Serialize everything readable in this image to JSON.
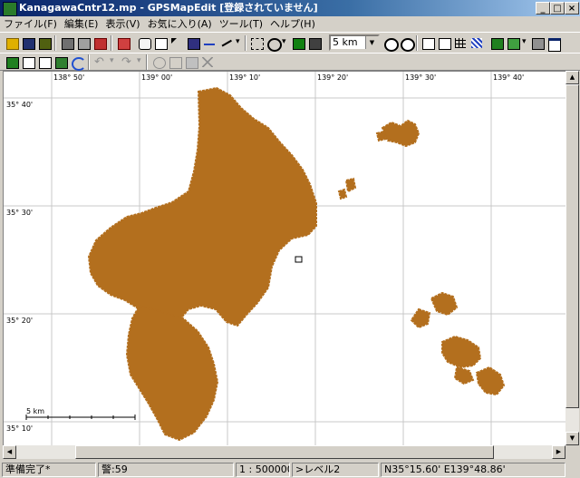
{
  "window": {
    "title": "KanagawaCntr12.mp - GPSMapEdit [登録されていません]"
  },
  "title_buttons": {
    "minimize": "_",
    "maximize": "□",
    "close": "×"
  },
  "menu": [
    "ファイル(F)",
    "編集(E)",
    "表示(V)",
    "お気に入り(A)",
    "ツール(T)",
    "ヘルプ(H)"
  ],
  "toolbar": {
    "scale_value": "5 km",
    "undo_label": "↶",
    "redo_label": "↷",
    "dropdown_arrow": "▾"
  },
  "map": {
    "land_color": "#b36f1e",
    "lon_labels": [
      "138° 50'",
      "139° 00'",
      "139° 10'",
      "139° 20'",
      "139° 30'",
      "139° 40'"
    ],
    "lat_labels": [
      "35° 40'",
      "35° 30'",
      "35° 20'",
      "35° 10'"
    ],
    "scale_bar_label": "5 km"
  },
  "status": {
    "ready": "準備完了*",
    "warnings": "警:59",
    "scale": "1 : 500000",
    "level": ">レベル2",
    "coords": "N35°15.60' E139°48.86'"
  }
}
